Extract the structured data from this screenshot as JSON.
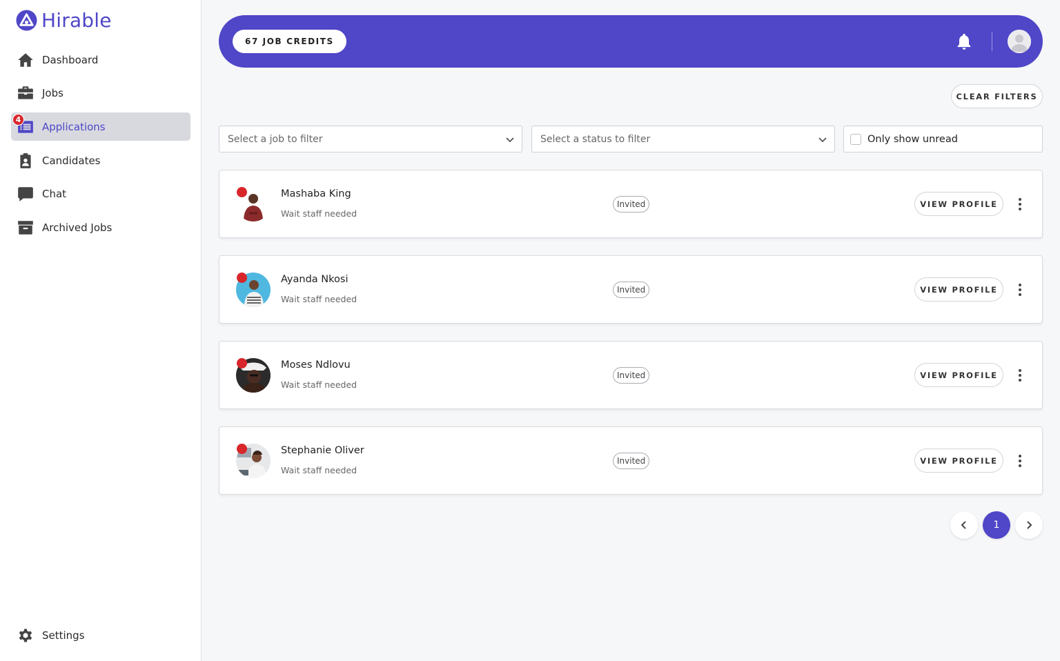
{
  "brand": {
    "name": "Hirable",
    "color": "#4f46c8"
  },
  "sidebar": {
    "items": [
      {
        "label": "Dashboard",
        "icon": "home-icon"
      },
      {
        "label": "Jobs",
        "icon": "briefcase-icon"
      },
      {
        "label": "Applications",
        "icon": "list-icon",
        "badge": "4",
        "active": true
      },
      {
        "label": "Candidates",
        "icon": "clipboard-user-icon"
      },
      {
        "label": "Chat",
        "icon": "chat-icon"
      },
      {
        "label": "Archived Jobs",
        "icon": "archive-icon"
      }
    ],
    "settings_label": "Settings"
  },
  "header": {
    "credits": "67 JOB CREDITS"
  },
  "filters": {
    "clear_label": "CLEAR FILTERS",
    "job_placeholder": "Select a job to filter",
    "status_placeholder": "Select a status to filter",
    "unread_label": "Only show unread"
  },
  "applications": [
    {
      "name": "Mashaba King",
      "job": "Wait staff needed",
      "status": "Invited",
      "action": "VIEW PROFILE"
    },
    {
      "name": "Ayanda Nkosi",
      "job": "Wait staff needed",
      "status": "Invited",
      "action": "VIEW PROFILE"
    },
    {
      "name": "Moses Ndlovu",
      "job": "Wait staff needed",
      "status": "Invited",
      "action": "VIEW PROFILE"
    },
    {
      "name": "Stephanie Oliver",
      "job": "Wait staff needed",
      "status": "Invited",
      "action": "VIEW PROFILE"
    }
  ],
  "pagination": {
    "current_page": "1"
  },
  "colors": {
    "accent": "#4f46c8",
    "unread_dot": "#d8262b",
    "badge": "#d8262b"
  }
}
